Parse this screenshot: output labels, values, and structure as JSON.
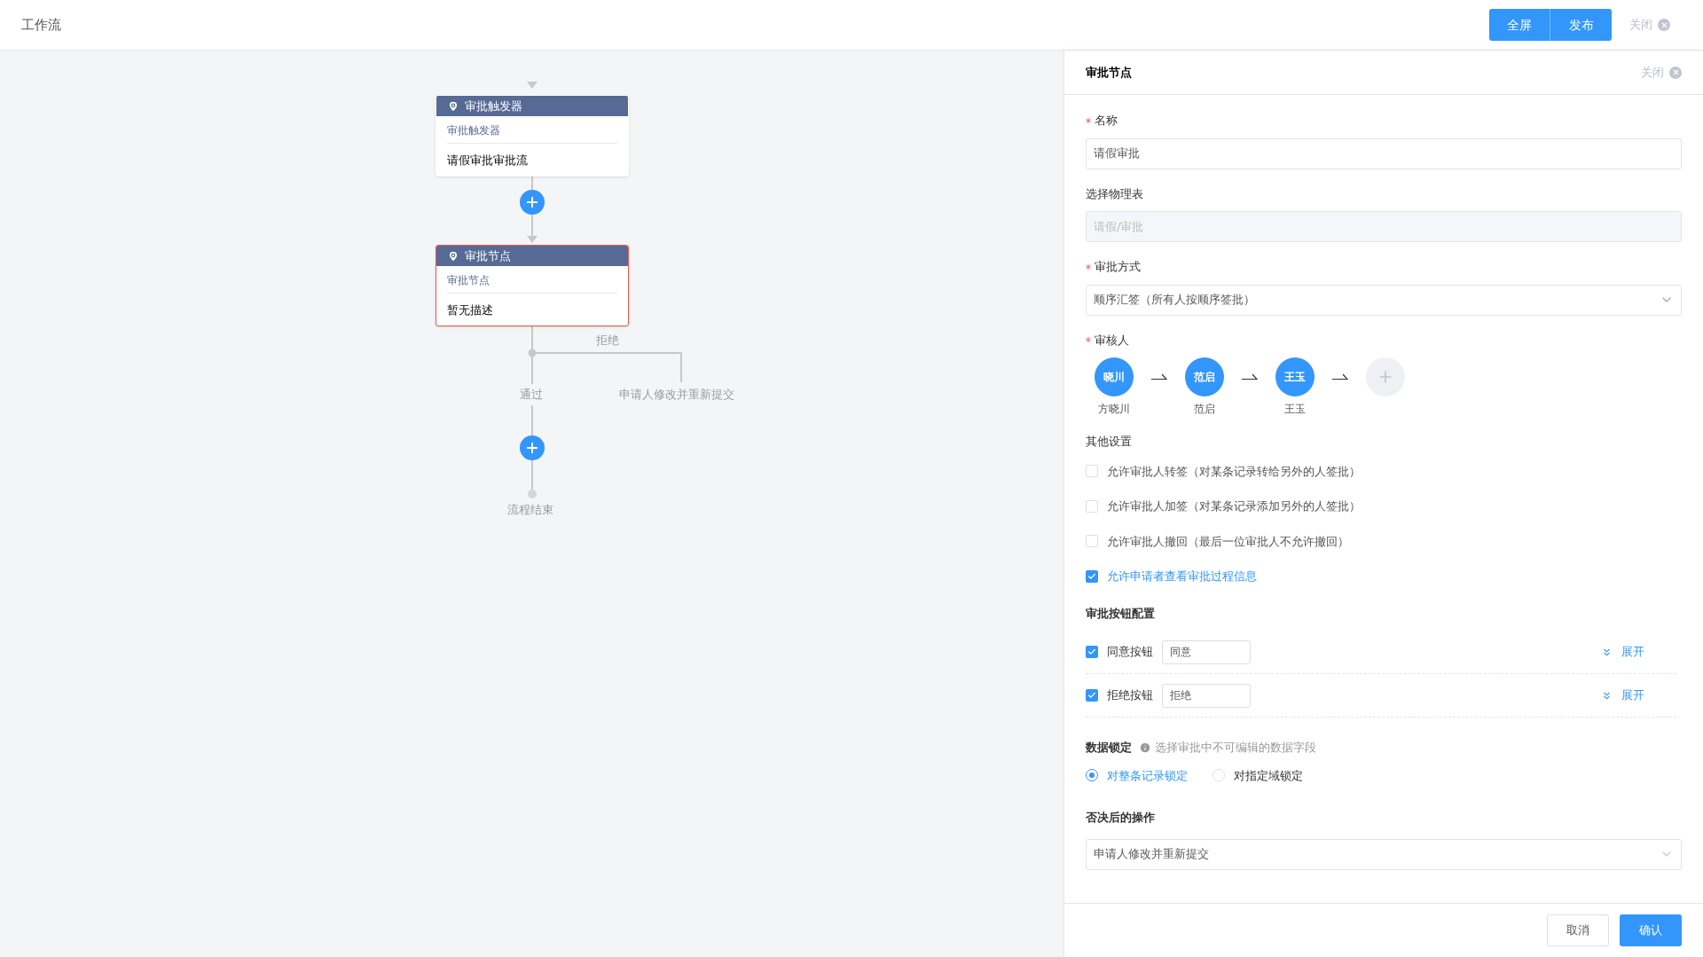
{
  "header": {
    "title": "工作流",
    "buttons": [
      {
        "label": "全屏"
      },
      {
        "label": "发布"
      }
    ],
    "close_label": "关闭"
  },
  "flow": {
    "nodes": [
      {
        "title": "审批触发器",
        "subtitle": "审批触发器",
        "description": "请假审批审批流",
        "selected": false
      },
      {
        "title": "审批节点",
        "subtitle": "审批节点",
        "description": "暂无描述",
        "selected": true
      }
    ],
    "branch": {
      "reject_label": "拒绝",
      "pass_label": "通过",
      "reject_action": "申请人修改并重新提交"
    },
    "end_label": "流程结束"
  },
  "panel": {
    "title": "审批节点",
    "close_label": "关闭",
    "fields": [
      {
        "kind": "input",
        "label": "名称",
        "required": true,
        "value": "请假审批"
      },
      {
        "kind": "disabled",
        "label": "选择物理表",
        "required": false,
        "value": "请假/审批"
      },
      {
        "kind": "select",
        "label": "审批方式",
        "required": true,
        "value": "顺序汇签（所有人按顺序签批）"
      }
    ],
    "approvers": {
      "label": "审核人",
      "required": true,
      "people": [
        {
          "avatar": "晓川",
          "name": "方晓川"
        },
        {
          "avatar": "范启",
          "name": "范启"
        },
        {
          "avatar": "王玉",
          "name": "王玉"
        }
      ]
    },
    "other_settings": {
      "title": "其他设置",
      "options": [
        {
          "label": "允许审批人转签（对某条记录转给另外的人签批）",
          "checked": false
        },
        {
          "label": "允许审批人加签（对某条记录添加另外的人签批）",
          "checked": false
        },
        {
          "label": "允许审批人撤回（最后一位审批人不允许撤回）",
          "checked": false
        },
        {
          "label": "允许申请者查看审批过程信息",
          "checked": true
        }
      ]
    },
    "button_config": {
      "title": "审批按钮配置",
      "rows": [
        {
          "label": "同意按钮",
          "checked": true,
          "value": "同意",
          "expand": "展开"
        },
        {
          "label": "拒绝按钮",
          "checked": true,
          "value": "拒绝",
          "expand": "展开"
        }
      ]
    },
    "data_lock": {
      "title": "数据锁定",
      "hint": "选择审批中不可编辑的数据字段",
      "options": [
        {
          "label": "对整条记录锁定",
          "selected": true
        },
        {
          "label": "对指定域锁定",
          "selected": false
        }
      ]
    },
    "reject_action": {
      "title": "否决后的操作",
      "value": "申请人修改并重新提交"
    },
    "footer": {
      "cancel": "取消",
      "confirm": "确认"
    }
  }
}
